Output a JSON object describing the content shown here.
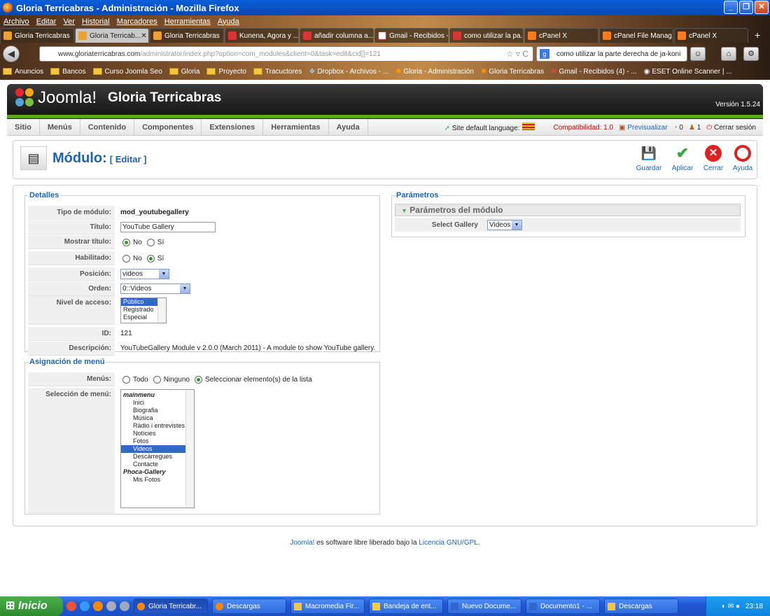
{
  "window": {
    "title": "Gloria Terricabras - Administración - Mozilla Firefox"
  },
  "menubar": [
    "Archivo",
    "Editar",
    "Ver",
    "Historial",
    "Marcadores",
    "Herramientas",
    "Ayuda"
  ],
  "tabs": [
    {
      "label": "Gloria Terricabras",
      "active": false
    },
    {
      "label": "Gloria Terricab...",
      "active": true
    },
    {
      "label": "Gloria Terricabras",
      "active": false
    },
    {
      "label": "Kunena, Agora y ...",
      "active": false
    },
    {
      "label": "añadir columna a...",
      "active": false
    },
    {
      "label": "Gmail - Recibidos -...",
      "active": false
    },
    {
      "label": "como utilizar la pa...",
      "active": false
    },
    {
      "label": "cPanel X",
      "active": false
    },
    {
      "label": "cPanel File Manag...",
      "active": false
    },
    {
      "label": "cPanel X",
      "active": false
    }
  ],
  "url": {
    "domain": "www.gloriaterricabras.com",
    "path": "/administrator/index.php?option=com_modules&client=0&task=edit&cid[]=121"
  },
  "search": {
    "value": "como utilizar la parte derecha de ja-koni"
  },
  "bookmarks": [
    "Anuncios",
    "Bancos",
    "Curso Joomla Seo",
    "Gloria",
    "Proyecto",
    "Tracuctores",
    "Dropbox - Archivos - ...",
    "Gloria - Administración",
    "Gloria Terricabras",
    "Gmail - Recibidos (4) - ...",
    "ESET Online Scanner | ..."
  ],
  "joomla": {
    "logo": "Joomla!",
    "site_name": "Gloria Terricabras",
    "version": "Versión 1.5.24",
    "menu": [
      "Sitio",
      "Menús",
      "Contenido",
      "Componentes",
      "Extensiones",
      "Herramientas",
      "Ayuda"
    ],
    "status": {
      "language": "Site default language:",
      "compat": "Compatibilidad: 1.0",
      "preview": "Previsualizar",
      "messages": "0",
      "users": "1",
      "logout": "Cerrar sesión"
    },
    "page_title": "Módulo:",
    "page_subtitle": "[ Editar ]",
    "toolbar": {
      "save": "Guardar",
      "apply": "Aplicar",
      "close": "Cerrar",
      "help": "Ayuda"
    }
  },
  "details": {
    "legend": "Detalles",
    "type_label": "Tipo de módulo:",
    "type_value": "mod_youtubegallery",
    "title_label": "Título:",
    "title_value": "YouTube Gallery",
    "show_title_label": "Mostrar título:",
    "no": "No",
    "yes": "Sí",
    "enabled_label": "Habilitado:",
    "position_label": "Posición:",
    "position_value": "videos",
    "order_label": "Orden:",
    "order_value": "0::Videos",
    "access_label": "Nivel de acceso:",
    "access_options": [
      "Público",
      "Registrado",
      "Especial"
    ],
    "id_label": "ID:",
    "id_value": "121",
    "desc_label": "Descripción:",
    "desc_value": "YouTubeGallery Module v 2.0.0 (March 2011) - A module to show YouTube gallery."
  },
  "menu_assign": {
    "legend": "Asignación de menú",
    "menus_label": "Menús:",
    "opt_all": "Todo",
    "opt_none": "Ninguno",
    "opt_select": "Seleccionar elemento(s) de la lista",
    "selection_label": "Selección de menú:",
    "items": [
      "mainmenu",
      "Inici",
      "Biografia",
      "Música",
      "Ràdio i entrevistes",
      "Notícies",
      "Fotos",
      "Videos",
      "Descàrregues",
      "Contacte",
      "Phoca-Gallery",
      "Mis Fotos"
    ]
  },
  "params": {
    "legend": "Parámetros",
    "head": "Parámetros del módulo",
    "gallery_label": "Select Gallery",
    "gallery_value": "Videos"
  },
  "footer": {
    "joomla": "Joomla!",
    "text": " es software libre liberado bajo la ",
    "license": "Licencia GNU/GPL",
    "end": "."
  },
  "taskbar": {
    "start": "Inicio",
    "items": [
      "Gloria Terricabr...",
      "Descargas",
      "Macromedia Fir...",
      "Bandeja de ent...",
      "Nuevo Docume...",
      "Documento1 - ...",
      "Descargas"
    ],
    "clock": "23:18"
  },
  "colors": {
    "joomla_blue": "#1a65b3",
    "joomla_green": "#5aaa1e",
    "xp_blue": "#1f58d4"
  }
}
